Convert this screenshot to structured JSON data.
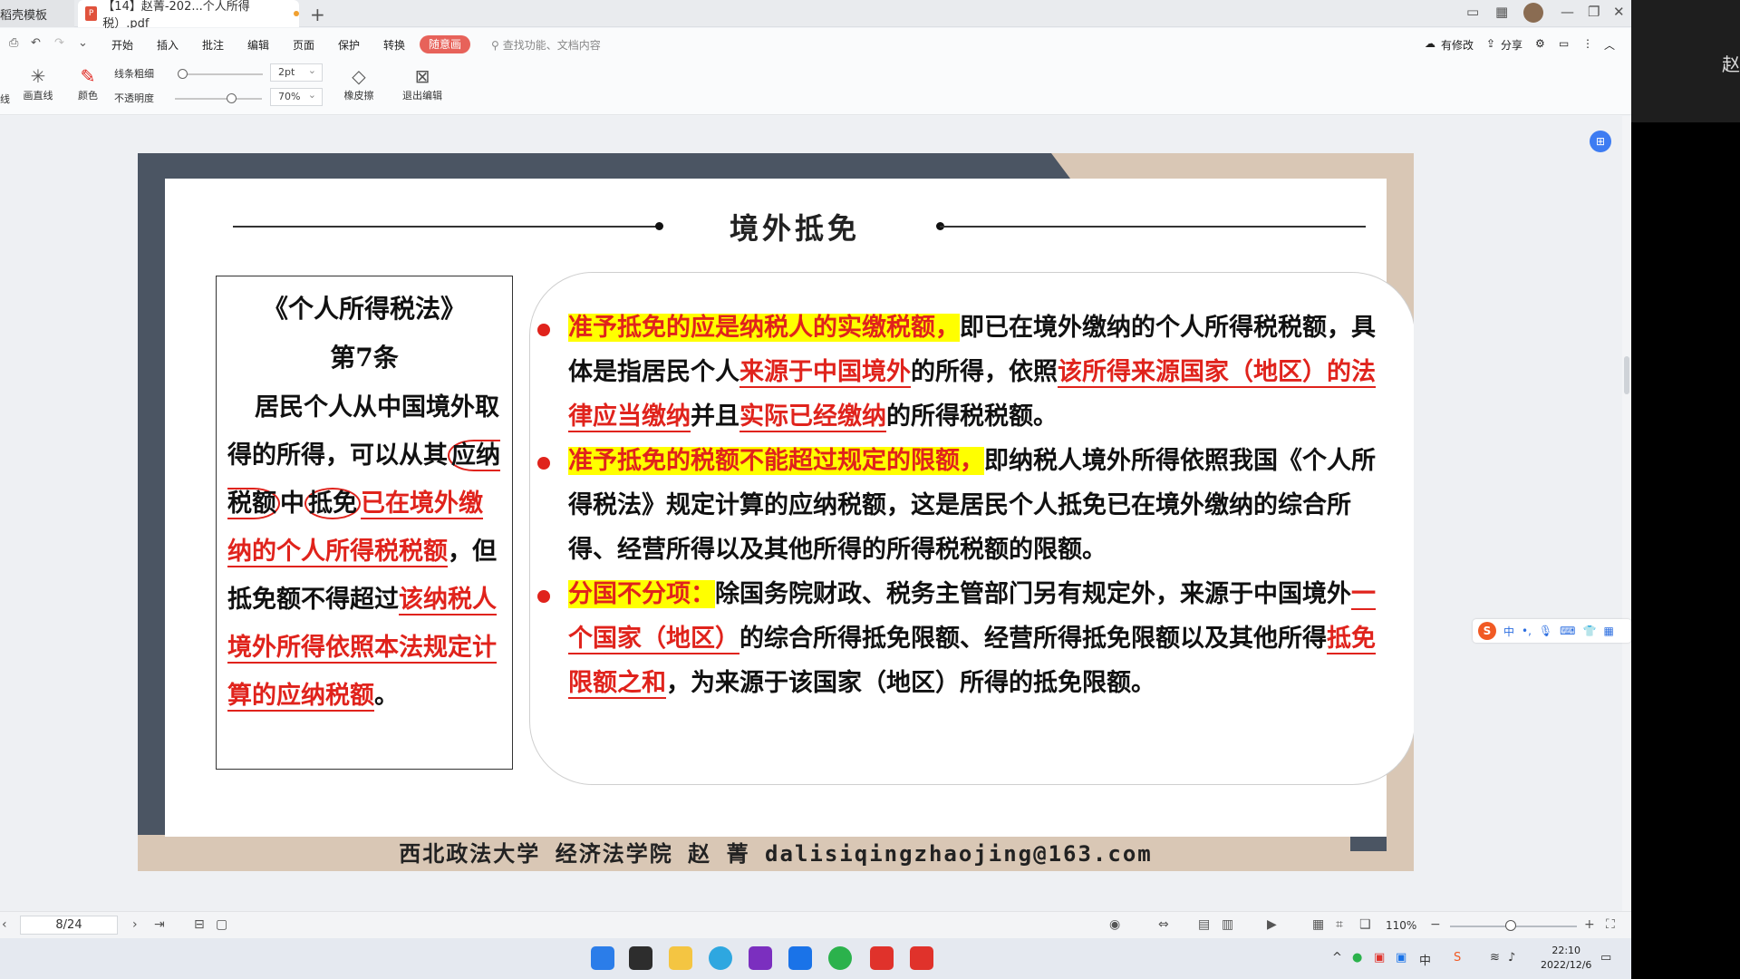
{
  "window": {
    "tabs": [
      {
        "label": "稻壳模板"
      },
      {
        "label": "【14】赵菁-202...个人所得税）.pdf",
        "modified": true
      }
    ]
  },
  "menu": {
    "items": [
      "开始",
      "插入",
      "批注",
      "编辑",
      "页面",
      "保护",
      "转换"
    ],
    "active": "随意画",
    "search_placeholder": "查找功能、文档内容",
    "right_actions": [
      "有修改",
      "分享"
    ]
  },
  "toolbar": {
    "line_tool": "线",
    "draw_line": "画直线",
    "color": "颜色",
    "line_width_label": "线条粗细",
    "line_width_value": "2pt",
    "opacity_label": "不透明度",
    "opacity_value": "70%",
    "eraser": "橡皮擦",
    "exit_edit": "退出编辑"
  },
  "slide": {
    "title": "境外抵免",
    "law": {
      "title": "《个人所得税法》",
      "article": "第7条",
      "body_parts": [
        {
          "text": "居民个人从中国境外取得的所得，可以从其",
          "style": "normal"
        },
        {
          "text": "应纳税额",
          "style": "circled"
        },
        {
          "text": "中",
          "style": "normal"
        },
        {
          "text": "抵免",
          "style": "circled"
        },
        {
          "text": "已在境外缴纳的个人所得税税额",
          "style": "red"
        },
        {
          "text": "，但抵免额不得超过",
          "style": "normal"
        },
        {
          "text": "该纳税人境外所得依照本法规定计算的应纳税额",
          "style": "red"
        },
        {
          "text": "。",
          "style": "normal"
        }
      ]
    },
    "points": [
      [
        {
          "text": "准予抵免的应是纳税人的实缴税额，",
          "style": "hl"
        },
        {
          "text": "即已在境外缴纳的个人所得税税额，具体是指居民个人",
          "style": "normal"
        },
        {
          "text": "来源于中国境外",
          "style": "red"
        },
        {
          "text": "的所得，依照",
          "style": "normal"
        },
        {
          "text": "该所得来源国家（地区）的法律应当缴纳",
          "style": "red"
        },
        {
          "text": "并且",
          "style": "normal"
        },
        {
          "text": "实际已经缴纳",
          "style": "red"
        },
        {
          "text": "的所得税税额。",
          "style": "normal"
        }
      ],
      [
        {
          "text": "准予抵免的税额不能超过规定的限额，",
          "style": "hl"
        },
        {
          "text": "即纳税人境外所得依照我国《个人所得税法》规定计算的应纳税额，这是居民个人抵免已在境外缴纳的综合所得、经营所得以及其他所得的所得税税额的限额。",
          "style": "normal"
        }
      ],
      [
        {
          "text": "分国不分项：",
          "style": "hl"
        },
        {
          "text": "除国务院财政、税务主管部门另有规定外，来源于中国境外",
          "style": "normal"
        },
        {
          "text": "一个国家（地区）",
          "style": "red"
        },
        {
          "text": "的综合所得抵免限额、经营所得抵免限额以及其他所得",
          "style": "normal"
        },
        {
          "text": "抵免限额之和",
          "style": "red"
        },
        {
          "text": "，为来源于该国家（地区）所得的抵免限额。",
          "style": "normal"
        }
      ]
    ],
    "footer": "西北政法大学 经济法学院 赵 菁 dalisiqingzhaojing@163.com"
  },
  "status": {
    "page": "8/24",
    "zoom": "110%"
  },
  "ime": {
    "lang": "中"
  },
  "taskbar": {
    "time": "22:10",
    "date": "2022/12/6"
  },
  "side_char": "赵",
  "colors": {
    "accent": "#e7625a",
    "red": "#e0231c",
    "highlight": "#ffff00"
  }
}
